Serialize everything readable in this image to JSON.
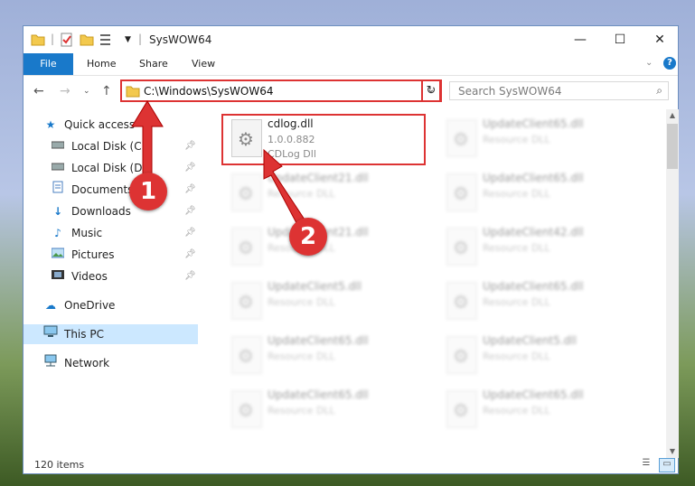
{
  "window": {
    "title": "SysWOW64",
    "controls": {
      "minimize": "—",
      "maximize": "☐",
      "close": "✕"
    }
  },
  "ribbon": {
    "file": "File",
    "tabs": [
      "Home",
      "Share",
      "View"
    ]
  },
  "nav": {
    "address": "C:\\Windows\\SysWOW64",
    "search_placeholder": "Search SysWOW64"
  },
  "sidebar": {
    "quick_access": "Quick access",
    "items": [
      {
        "label": "Local Disk (C:)",
        "icon": "drive-icon"
      },
      {
        "label": "Local Disk (D:)",
        "icon": "drive-icon"
      },
      {
        "label": "Documents",
        "icon": "documents-icon"
      },
      {
        "label": "Downloads",
        "icon": "downloads-icon"
      },
      {
        "label": "Music",
        "icon": "music-icon"
      },
      {
        "label": "Pictures",
        "icon": "pictures-icon"
      },
      {
        "label": "Videos",
        "icon": "videos-icon"
      }
    ],
    "onedrive": "OneDrive",
    "this_pc": "This PC",
    "network": "Network"
  },
  "files": {
    "highlighted": {
      "name": "cdlog.dll",
      "version": "1.0.0.882",
      "description": "CDLog Dll"
    },
    "col_left": [
      {
        "name": "UpdateClient21.dll",
        "description": "Resource DLL"
      },
      {
        "name": "UpdateClient21.dll",
        "description": "Resource DLL"
      },
      {
        "name": "UpdateClient5.dll",
        "description": "Resource DLL"
      },
      {
        "name": "UpdateClient65.dll",
        "description": "Resource DLL"
      },
      {
        "name": "UpdateClient65.dll",
        "description": "Resource DLL"
      }
    ],
    "col_right": [
      {
        "name": "UpdateClient65.dll",
        "description": "Resource DLL"
      },
      {
        "name": "UpdateClient65.dll",
        "description": "Resource DLL"
      },
      {
        "name": "UpdateClient42.dll",
        "description": "Resource DLL"
      },
      {
        "name": "UpdateClient65.dll",
        "description": "Resource DLL"
      },
      {
        "name": "UpdateClient5.dll",
        "description": "Resource DLL"
      },
      {
        "name": "UpdateClient65.dll",
        "description": "Resource DLL"
      }
    ]
  },
  "status": {
    "count": "120 items"
  },
  "annotations": {
    "step1": "1",
    "step2": "2",
    "color": "#dd3333"
  }
}
